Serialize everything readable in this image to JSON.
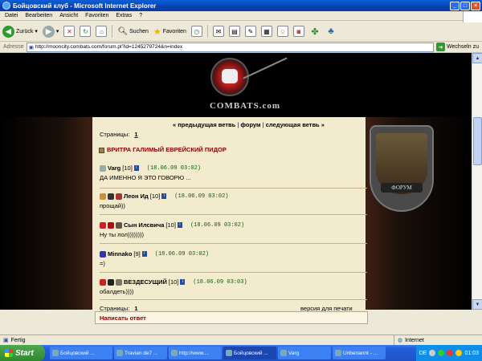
{
  "window": {
    "title": "Бойцовский клуб - Microsoft Internet Explorer"
  },
  "menu": [
    "Datei",
    "Bearbeiten",
    "Ansicht",
    "Favoriten",
    "Extras",
    "?"
  ],
  "toolbar": {
    "back_label": "Zurück",
    "search_label": "Suchen",
    "favorites_label": "Favoriten"
  },
  "address": {
    "label": "Adresse",
    "url": "http://mooncity.combats.com/forum.pl?id=1245279724&n=index",
    "go_label": "Wechseln zu"
  },
  "banner": {
    "brand": "COMBATS.com"
  },
  "shield": {
    "label": "ФОРУМ"
  },
  "forum": {
    "pages_label": "Страницы:",
    "page_number": "1",
    "nav": {
      "prev": "« предыдущая ветвь",
      "sep1": "|",
      "forum": "форум",
      "sep2": "|",
      "next": "следующая ветвь »"
    },
    "topic_title": "ВРИТРА ГАЛИМЫЙ ЕВРЕЙСКИЙ ПИДОР",
    "posts": [
      {
        "name": "Varg",
        "level": "[10]",
        "date": "(18.06.09 03:02)",
        "body": "ДА ИМЕННО Я ЭТО ГОВОРЮ ..."
      },
      {
        "name": "Леон Ид",
        "level": "[10]",
        "date": "(18.06.09 03:02)",
        "body": "прощай))"
      },
      {
        "name": "Сын Илсвича",
        "level": "[10]",
        "date": "(18.06.09 03:02)",
        "body": "Ну ты лол))))))))"
      },
      {
        "name": "Minnako",
        "level": "[9]",
        "date": "(18.06.09 03:02)",
        "body": "=)"
      },
      {
        "name": "ВЕЗДЕСУЩИЙ",
        "level": "[10]",
        "date": "(18.06.09 03:03)",
        "body": "обалдеть))))"
      }
    ],
    "bottom_pages_label": "Страницы:",
    "bottom_page_number": "1",
    "print_version": "версия для печати",
    "reply_title": "Написать ответ"
  },
  "status": {
    "left": "Fertig",
    "zone": "Internet"
  },
  "taskbar": {
    "start": "Start",
    "tasks": [
      "Бойцовский ...",
      "Travian de7 ...",
      "http://www....",
      "Бойцовский ...",
      "Varg",
      "Unbenannt - ..."
    ],
    "lang": "DE",
    "clock": "01:03"
  },
  "colors": {
    "topic": "#8b0000",
    "date": "#0a5c0a",
    "parchment": "#f3ebcd"
  }
}
